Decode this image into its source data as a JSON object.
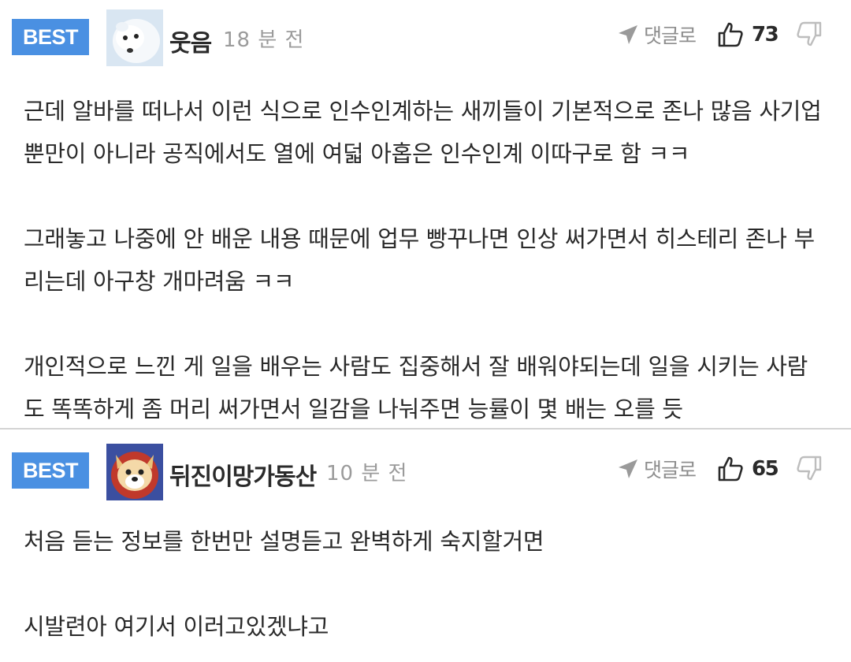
{
  "comments": [
    {
      "badge": "BEST",
      "nickname": "웃음",
      "time": "18 분 전",
      "reply_label": "댓글로",
      "likes": "73",
      "paragraphs": [
        [
          "근데 알바를 떠나서 이런 식으로 인수인계하는 새끼들이 기본적으로 존나 많음 사기업",
          "뿐만이 아니라 공직에서도 열에 여덟 아홉은 인수인계 이따구로 함 ㅋㅋ"
        ],
        [
          "그래놓고 나중에 안 배운 내용 때문에 업무 빵꾸나면 인상 써가면서 히스테리 존나 부",
          "리는데 아구창 개마려움 ㅋㅋ"
        ],
        [
          "개인적으로 느낀 게 일을 배우는 사람도 집중해서 잘 배워야되는데 일을 시키는 사람",
          "도 똑똑하게 좀 머리 써가면서 일감을 나눠주면 능률이 몇 배는 오를 듯"
        ]
      ]
    },
    {
      "badge": "BEST",
      "nickname": "뒤진이망가동산",
      "time": "10 분 전",
      "reply_label": "댓글로",
      "likes": "65",
      "paragraphs": [
        [
          "처음 듣는 정보를 한번만 설명듣고 완벽하게 숙지할거면"
        ],
        [
          "시발련아 여기서 이러고있겠냐고"
        ]
      ]
    }
  ],
  "colors": {
    "badge": "#4a90e2",
    "time": "#9b9b9b",
    "divider": "#d4d4d4"
  },
  "icons": {
    "reply": "send-arrow-icon",
    "like": "thumbs-up-icon",
    "dislike": "thumbs-down-icon"
  }
}
